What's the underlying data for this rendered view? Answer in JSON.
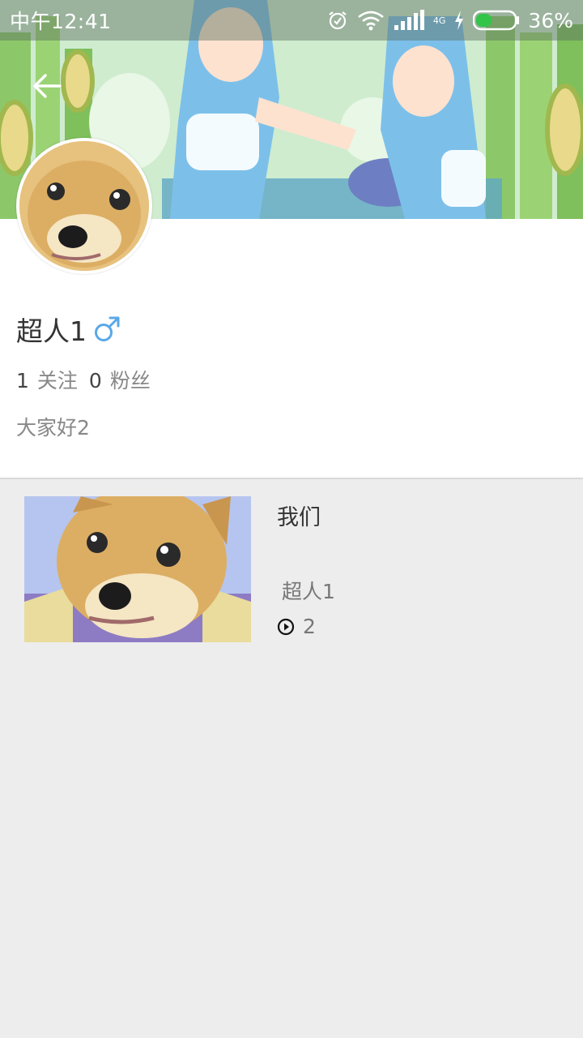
{
  "status_bar": {
    "time": "中午12:41",
    "battery_percent": "36%",
    "icons": [
      "alarm-icon",
      "wifi-icon",
      "signal-icon",
      "charging-icon",
      "battery-icon"
    ],
    "network_badge": "4G"
  },
  "header": {
    "back_icon": "back-arrow-icon"
  },
  "profile": {
    "username": "超人1",
    "gender": "male",
    "following_count": "1",
    "following_label": "关注",
    "followers_count": "0",
    "followers_label": "粉丝",
    "bio": "大家好2"
  },
  "videos": [
    {
      "title": "我们",
      "author": "超人1",
      "play_count": "2"
    }
  ],
  "colors": {
    "gender_male": "#5aa8e8",
    "background": "#ededed",
    "card": "#ffffff"
  }
}
